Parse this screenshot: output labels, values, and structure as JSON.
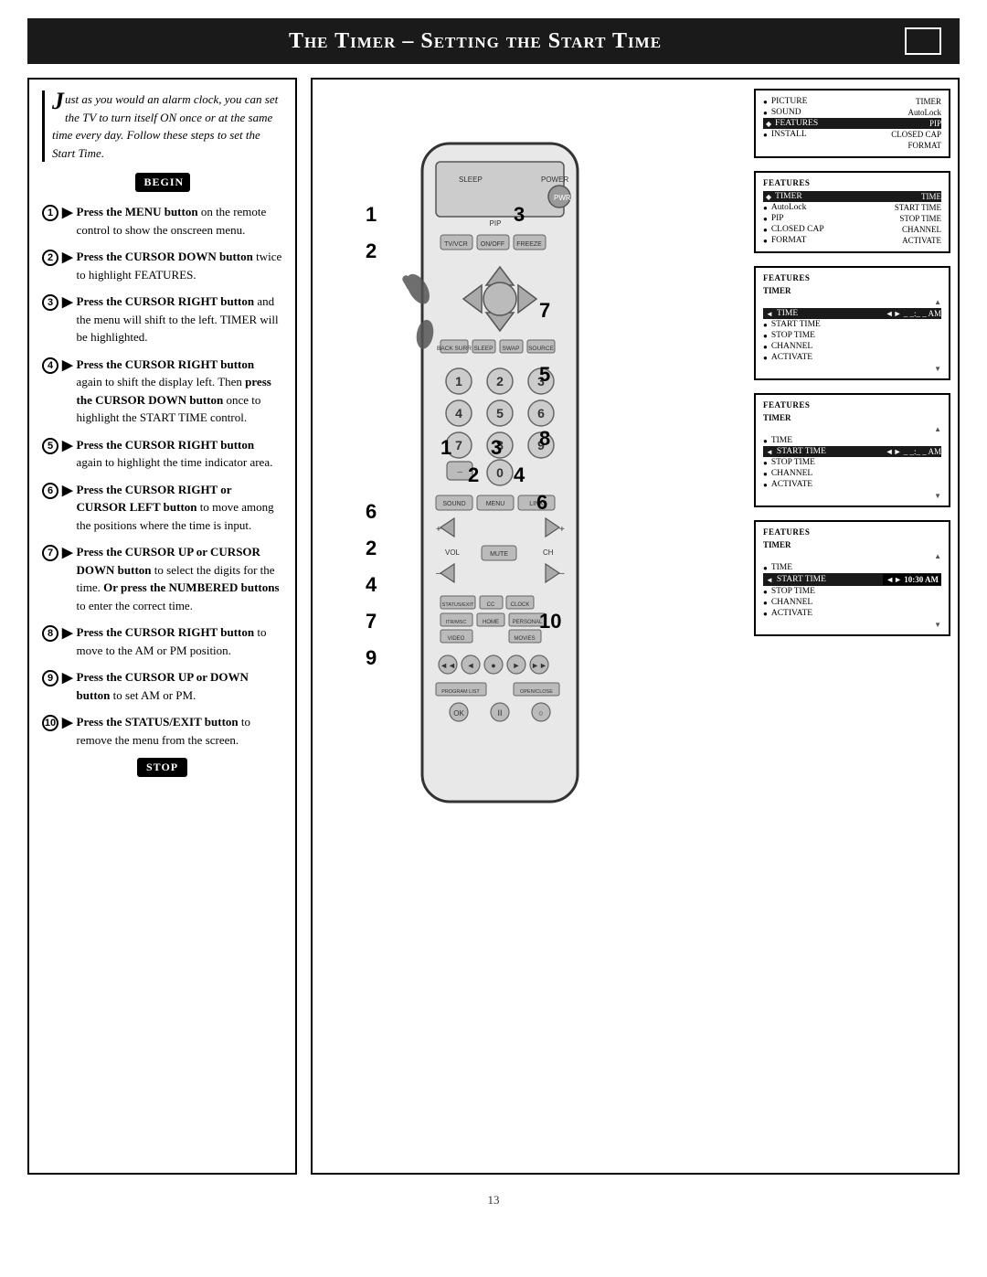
{
  "title": "The Timer – Setting the Start Time",
  "intro": {
    "drop_cap": "J",
    "text": "ust as you would an alarm clock, you can set the TV to turn itself ON once or at the same time every day. Follow these steps to set the Start Time."
  },
  "begin_label": "BEGIN",
  "stop_label": "STOP",
  "steps": [
    {
      "num": "1",
      "text_bold": "Press the MENU button",
      "text_rest": " on the remote control to show the onscreen menu."
    },
    {
      "num": "2",
      "text_bold": "Press the CURSOR DOWN button",
      "text_rest": " twice to highlight FEATURES."
    },
    {
      "num": "3",
      "text_bold": "Press the CURSOR RIGHT button",
      "text_rest": " and the menu will shift to the left. TIMER will be highlighted."
    },
    {
      "num": "4",
      "text_bold": "Press the CURSOR RIGHT button",
      "text_rest": " again to shift the display left. Then press the CURSOR DOWN button once to highlight the START TIME control."
    },
    {
      "num": "5",
      "text_bold": "Press the CURSOR RIGHT button",
      "text_rest": " again to highlight the time indicator area."
    },
    {
      "num": "6",
      "text_bold": "Press the CURSOR RIGHT or CURSOR LEFT button",
      "text_rest": " to move among the positions where the time is input."
    },
    {
      "num": "7",
      "text_bold": "Press the CURSOR UP or CURSOR DOWN button",
      "text_rest": " to select the digits for the time. Or press the NUMBERED buttons to enter the correct time."
    },
    {
      "num": "8",
      "text_bold": "Press the CURSOR RIGHT button",
      "text_rest": " to move to the AM or PM position."
    },
    {
      "num": "9",
      "text_bold": "Press the CURSOR UP or DOWN button",
      "text_rest": " to set AM or PM."
    },
    {
      "num": "10",
      "text_bold": "Press the STATUS/EXIT button",
      "text_rest": " to remove the menu from the screen."
    }
  ],
  "panels": [
    {
      "id": "panel1",
      "items": [
        {
          "label": "PICTURE",
          "right": "TIMER",
          "active": false
        },
        {
          "label": "SOUND",
          "right": "AutoLock",
          "active": false
        },
        {
          "label": "FEATURES",
          "right": "PIP",
          "active": true
        },
        {
          "label": "INSTALL",
          "right": "CLOSED CAP",
          "active": false
        },
        {
          "label": "",
          "right": "FORMAT",
          "active": false
        }
      ]
    },
    {
      "id": "panel2",
      "title": "FEATURES",
      "items": [
        {
          "label": "TIMER",
          "right": "TIME",
          "active": true
        },
        {
          "label": "AutoLock",
          "right": "START TIME",
          "active": false
        },
        {
          "label": "PIP",
          "right": "STOP TIME",
          "active": false
        },
        {
          "label": "CLOSED CAP",
          "right": "CHANNEL",
          "active": false
        },
        {
          "label": "FORMAT",
          "right": "ACTIVATE",
          "active": false
        }
      ]
    },
    {
      "id": "panel3",
      "title": "FEATURES",
      "sub": "TIMER",
      "items": [
        {
          "label": "TIME",
          "right": "◄► _ _ : _ _ AM",
          "active": true
        },
        {
          "label": "START TIME",
          "right": "",
          "active": false
        },
        {
          "label": "STOP TIME",
          "right": "",
          "active": false
        },
        {
          "label": "CHANNEL",
          "right": "",
          "active": false
        },
        {
          "label": "ACTIVATE",
          "right": "",
          "active": false
        }
      ]
    },
    {
      "id": "panel4",
      "title": "FEATURES",
      "sub": "TIMER",
      "items": [
        {
          "label": "TIME",
          "right": "",
          "active": false
        },
        {
          "label": "START TIME",
          "right": "◄► _ _ : _ _ AM",
          "active": true
        },
        {
          "label": "STOP TIME",
          "right": "",
          "active": false
        },
        {
          "label": "CHANNEL",
          "right": "",
          "active": false
        },
        {
          "label": "ACTIVATE",
          "right": "",
          "active": false
        }
      ]
    },
    {
      "id": "panel5",
      "title": "FEATURES",
      "sub": "TIMER",
      "items": [
        {
          "label": "TIME",
          "right": "",
          "active": false
        },
        {
          "label": "START TIME",
          "right": "◄► 10:30 AM",
          "active": true
        },
        {
          "label": "STOP TIME",
          "right": "",
          "active": false
        },
        {
          "label": "CHANNEL",
          "right": "",
          "active": false
        },
        {
          "label": "ACTIVATE",
          "right": "",
          "active": false
        }
      ]
    }
  ],
  "page_number": "13"
}
